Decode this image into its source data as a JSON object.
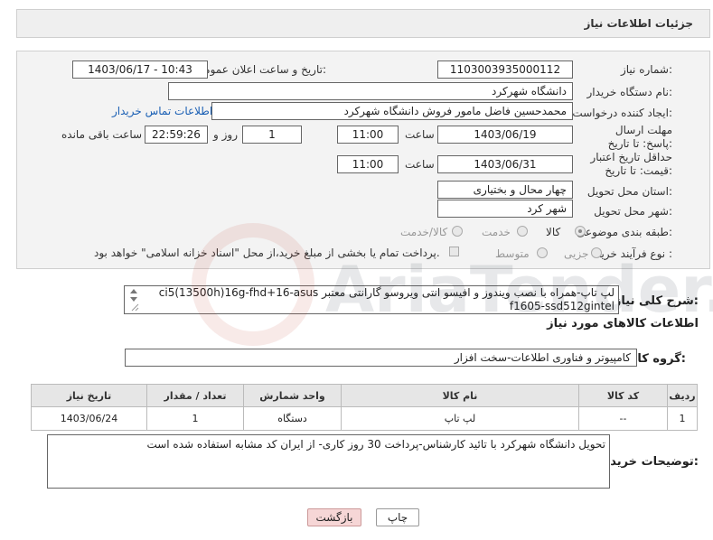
{
  "header": {
    "title": "جزئیات اطلاعات نیاز"
  },
  "form": {
    "need_number_label": "شماره نیاز:",
    "need_number": "1103003935000112",
    "announce_label": "تاریخ و ساعت اعلان عمومی:",
    "announce_value": "1403/06/17 - 10:43",
    "buyer_label": "نام دستگاه خریدار:",
    "buyer_value": "دانشگاه شهرکرد",
    "creator_label": "ایجاد کننده درخواست:",
    "creator_value": "محمدحسین فاضل مامور فروش دانشگاه شهرکرد",
    "contact_link": "اطلاعات تماس خریدار",
    "deadline_label": "مهلت ارسال پاسخ: تا تاریخ:",
    "deadline_date": "1403/06/19",
    "time_label": "ساعت",
    "deadline_time": "11:00",
    "days_value": "1",
    "days_label": "روز و",
    "remaining_time": "22:59:26",
    "remaining_label": "ساعت باقی مانده",
    "validity_label": "حداقل تاریخ اعتبار قیمت: تا تاریخ:",
    "validity_date": "1403/06/31",
    "validity_time": "11:00",
    "province_label": "استان محل تحویل:",
    "province_value": "چهار محال و بختیاری",
    "city_label": "شهر محل تحویل:",
    "city_value": "شهر کرد",
    "category_label": "طبقه بندی موضوعی:",
    "category_options": [
      "کالا",
      "خدمت",
      "کالا/خدمت"
    ],
    "category_selected": "کالا",
    "process_label": "نوع فرآیند خرید :",
    "process_options": [
      "جزیی",
      "متوسط"
    ],
    "payment_note": "پرداخت تمام یا بخشی از مبلغ خرید،از محل \"اسناد خزانه اسلامی\" خواهد بود."
  },
  "description": {
    "label": "شرح کلی نیاز:",
    "text": "لپ تاپ-همراه با نصب ویندوز و افیسو انتی ویروسو گارانتی معتبر ci5(13500h)16g-fhd+16-asus f1605-ssd512gintel"
  },
  "goods": {
    "section_title": "اطلاعات کالاهای مورد نیاز",
    "group_label": "گروه کالا:",
    "group_value": "کامپیوتر و فناوری اطلاعات-سخت افزار",
    "columns": [
      "ردیف",
      "کد کالا",
      "نام کالا",
      "واحد شمارش",
      "تعداد / مقدار",
      "تاریخ نیاز"
    ],
    "rows": [
      {
        "row": "1",
        "code": "--",
        "name": "لپ تاپ",
        "unit": "دستگاه",
        "qty": "1",
        "date": "1403/06/24"
      }
    ]
  },
  "notes": {
    "label": "توضیحات خریدار:",
    "text": "تحویل دانشگاه شهرکرد با تائید کارشناس-پرداخت 30 روز کاری- از ایران کد مشابه استفاده شده است"
  },
  "buttons": {
    "print": "چاپ",
    "back": "بازگشت"
  },
  "watermark": {
    "text": "AriaTender.net"
  },
  "colors": {
    "link": "#1a5fb4",
    "back_button_bg": "#f6d6d6",
    "print_button_bg": "#ffffff",
    "header_bg": "#efefef",
    "panel_bg": "#f3f3f3"
  }
}
